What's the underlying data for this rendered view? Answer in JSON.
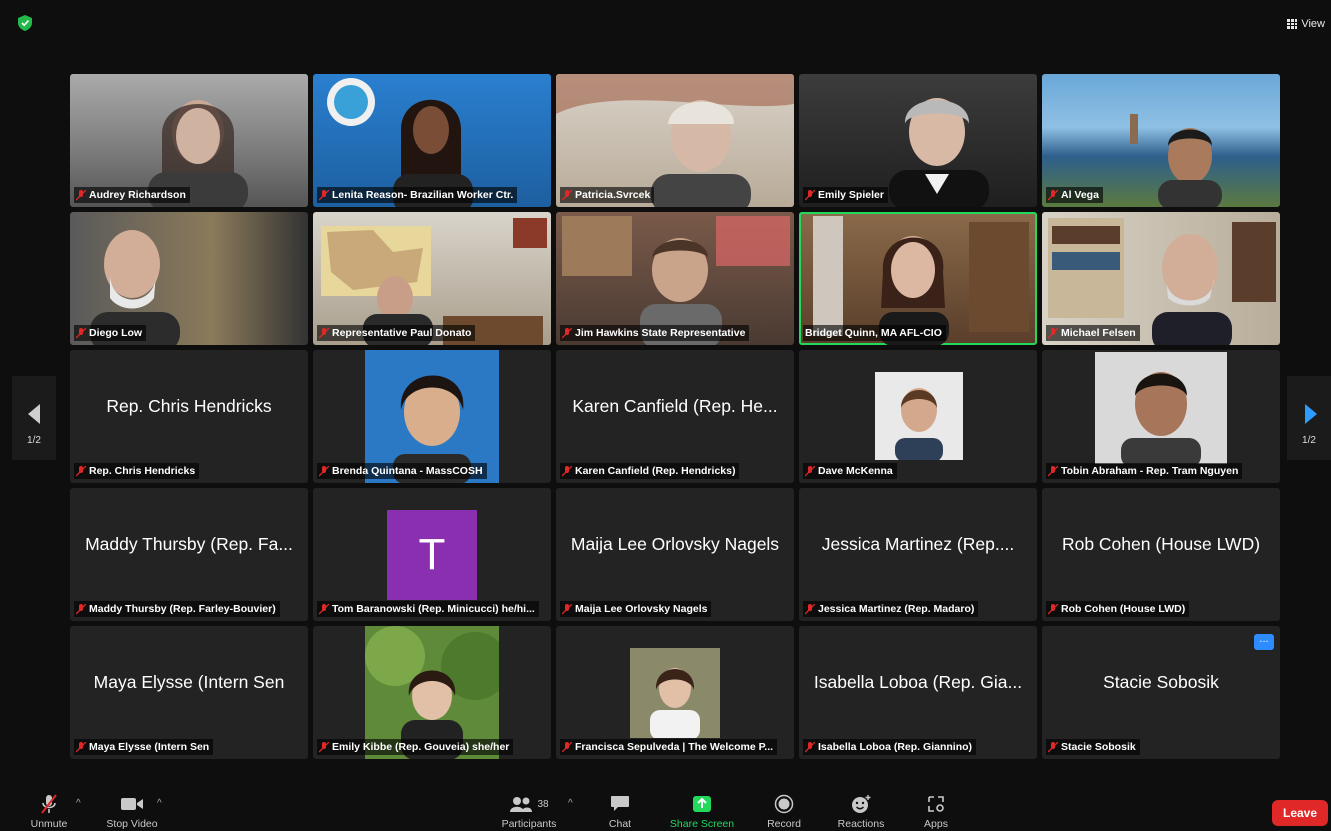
{
  "top": {
    "view_label": "View"
  },
  "pager": {
    "left": "1/2",
    "right": "1/2"
  },
  "tiles": [
    {
      "name": "Audrey Richardson"
    },
    {
      "name": "Lenita Reason- Brazilian Worker Ctr."
    },
    {
      "name": "Patricia.Svrcek"
    },
    {
      "name": "Emily Spieler"
    },
    {
      "name": "Al Vega"
    },
    {
      "name": "Diego Low"
    },
    {
      "name": "Representative Paul Donato"
    },
    {
      "name": "Jim Hawkins State Representative"
    },
    {
      "name": "Bridget Quinn, MA AFL-CIO"
    },
    {
      "name": "Michael Felsen"
    },
    {
      "name": "Rep. Chris Hendricks",
      "display": "Rep. Chris Hendricks"
    },
    {
      "name": "Brenda Quintana - MassCOSH"
    },
    {
      "name": "Karen Canfield (Rep. Hendricks)",
      "display": "Karen Canfield (Rep. He..."
    },
    {
      "name": "Dave McKenna"
    },
    {
      "name": "Tobin Abraham - Rep. Tram Nguyen"
    },
    {
      "name": "Maddy Thursby (Rep. Farley-Bouvier)",
      "display": "Maddy Thursby (Rep. Fa..."
    },
    {
      "name": "Tom Baranowski (Rep. Minicucci) he/hi...",
      "avatar": "T"
    },
    {
      "name": "Maija Lee Orlovsky Nagels",
      "display": "Maija Lee Orlovsky Nagels"
    },
    {
      "name": "Jessica Martinez (Rep. Madaro)",
      "display": "Jessica Martinez (Rep...."
    },
    {
      "name": "Rob Cohen (House LWD)",
      "display": "Rob Cohen (House LWD)"
    },
    {
      "name": "Maya Elysse (Intern Sen",
      "display": "Maya Elysse (Intern Sen"
    },
    {
      "name": "Emily Kibbe (Rep. Gouveia) she/her"
    },
    {
      "name": "Francisca Sepulveda | The Welcome P..."
    },
    {
      "name": "Isabella Loboa (Rep. Giannino)",
      "display": "Isabella Loboa (Rep. Gia..."
    },
    {
      "name": "Stacie Sobosik",
      "display": "Stacie Sobosik",
      "more": "..."
    }
  ],
  "toolbar": {
    "unmute": "Unmute",
    "stop_video": "Stop Video",
    "participants_count": "38",
    "participants": "Participants",
    "chat": "Chat",
    "share_screen": "Share Screen",
    "record": "Record",
    "reactions": "Reactions",
    "apps": "Apps",
    "leave": "Leave"
  },
  "colors": {
    "accent": "#23d95b",
    "leave": "#e02828",
    "share": "#23d95b",
    "more_button": "#2d8cff",
    "avatar_bg": "#8a2fb0"
  }
}
